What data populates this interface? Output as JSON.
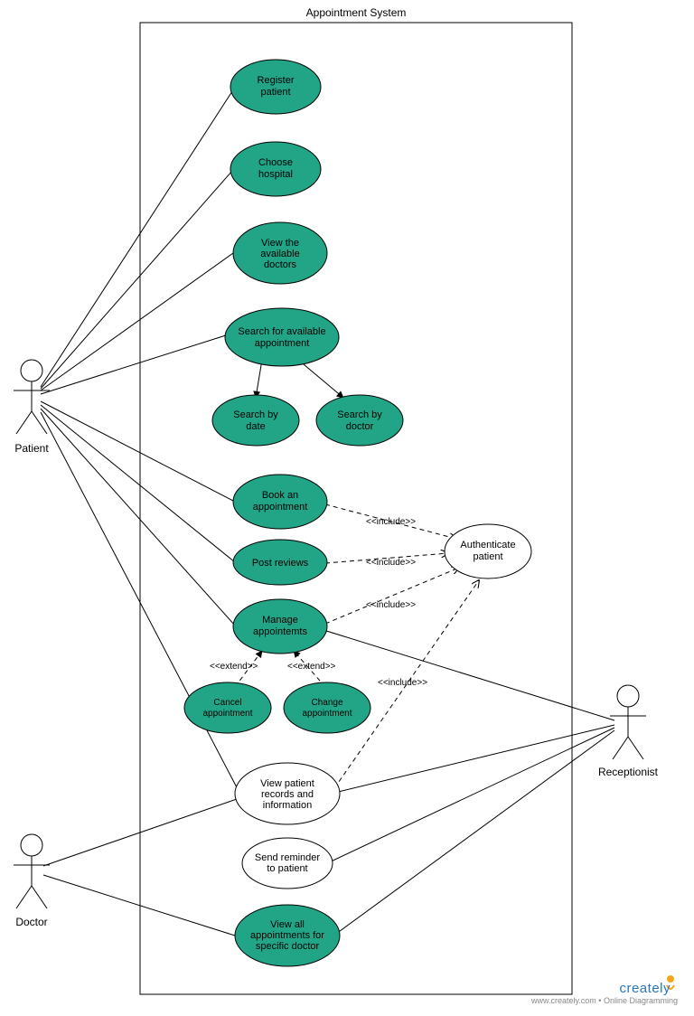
{
  "system": {
    "title": "Appointment System"
  },
  "actors": {
    "patient": "Patient",
    "doctor": "Doctor",
    "receptionist": "Receptionist"
  },
  "usecases": {
    "register": "Register patient",
    "choose": "Choose hospital",
    "viewDoctors1": "View the",
    "viewDoctors2": "available",
    "viewDoctors3": "doctors",
    "searchAvail1": "Search for available",
    "searchAvail2": "appointment",
    "byDate1": "Search by",
    "byDate2": "date",
    "byDoctor1": "Search by",
    "byDoctor2": "doctor",
    "book1": "Book an",
    "book2": "appointment",
    "post": "Post reviews",
    "manage1": "Manage",
    "manage2": "appointemts",
    "cancel1": "Cancel",
    "cancel2": "appointment",
    "change1": "Change",
    "change2": "appointment",
    "auth1": "Authenticate",
    "auth2": "patient",
    "viewRec1": "View patient",
    "viewRec2": "records and",
    "viewRec3": "information",
    "remind1": "Send reminder",
    "remind2": "to patient",
    "viewAll1": "View all",
    "viewAll2": "appointments for",
    "viewAll3": "specific doctor"
  },
  "rel": {
    "include": "<<include>>",
    "extend": "<<extend>>"
  },
  "footer": {
    "brand": "creately",
    "tagline": "www.creately.com • Online Diagramming"
  }
}
